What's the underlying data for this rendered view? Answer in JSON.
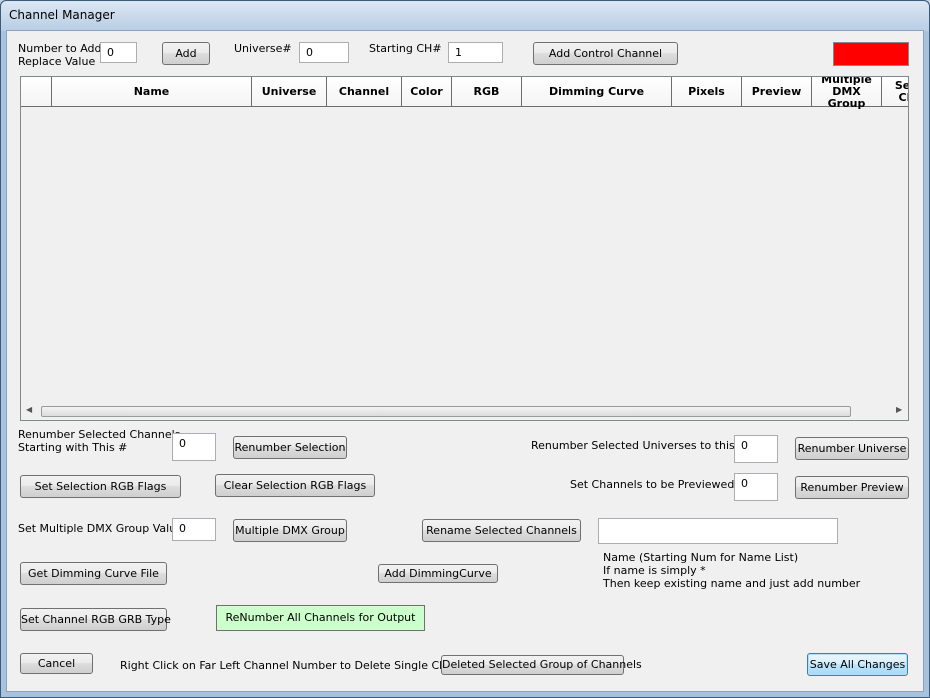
{
  "window": {
    "title": "Channel Manager"
  },
  "top": {
    "number_label_1": "Number to Add",
    "number_label_2": "Replace Value",
    "number_value": "0",
    "add_button": "Add",
    "universe_label": "Universe#",
    "universe_value": "0",
    "starting_ch_label": "Starting CH#",
    "starting_ch_value": "1",
    "add_control_channel_button": "Add Control Channel",
    "color_swatch": "#ff0000"
  },
  "grid": {
    "columns": [
      "Name",
      "Universe",
      "Channel",
      "Color",
      "RGB",
      "Dimming Curve",
      "Pixels",
      "Preview",
      "Multiple DMX Group",
      "Seg Ch"
    ]
  },
  "controls": {
    "renumber_label_1": "Renumber Selected Channels",
    "renumber_label_2": "Starting with This #",
    "renumber_value": "0",
    "renumber_selection_button": "Renumber Selection",
    "renumber_universes_label": "Renumber Selected Universes to this #",
    "renumber_universes_value": "0",
    "renumber_universe_button": "Renumber Universe",
    "set_rgb_flags_button": "Set Selection RGB Flags",
    "clear_rgb_flags_button": "Clear Selection RGB Flags",
    "preview_label": "Set Channels to be Previewed",
    "preview_value": "0",
    "renumber_preview_button": "Renumber Preview",
    "dmx_group_label": "Set Multiple DMX Group Value",
    "dmx_group_value": "0",
    "multiple_dmx_group_button": "Multiple DMX Group",
    "rename_selected_button": "Rename Selected Channels",
    "rename_value": "",
    "rename_hint_1": "Name (Starting Num for Name List)",
    "rename_hint_2": "If name is simply *",
    "rename_hint_3": "Then keep existing name and just add number",
    "get_dimming_curve_button": "Get Dimming Curve File",
    "add_dimming_curve_button": "Add DimmingCurve",
    "set_rgb_grb_button": "Set Channel RGB GRB Type",
    "renumber_all_button": "ReNumber All Channels for Output",
    "cancel_button": "Cancel",
    "right_click_hint": "Right Click on Far Left Channel Number to Delete Single Channel",
    "delete_group_button": "Deleted Selected Group of Channels",
    "save_button": "Save All Changes"
  }
}
